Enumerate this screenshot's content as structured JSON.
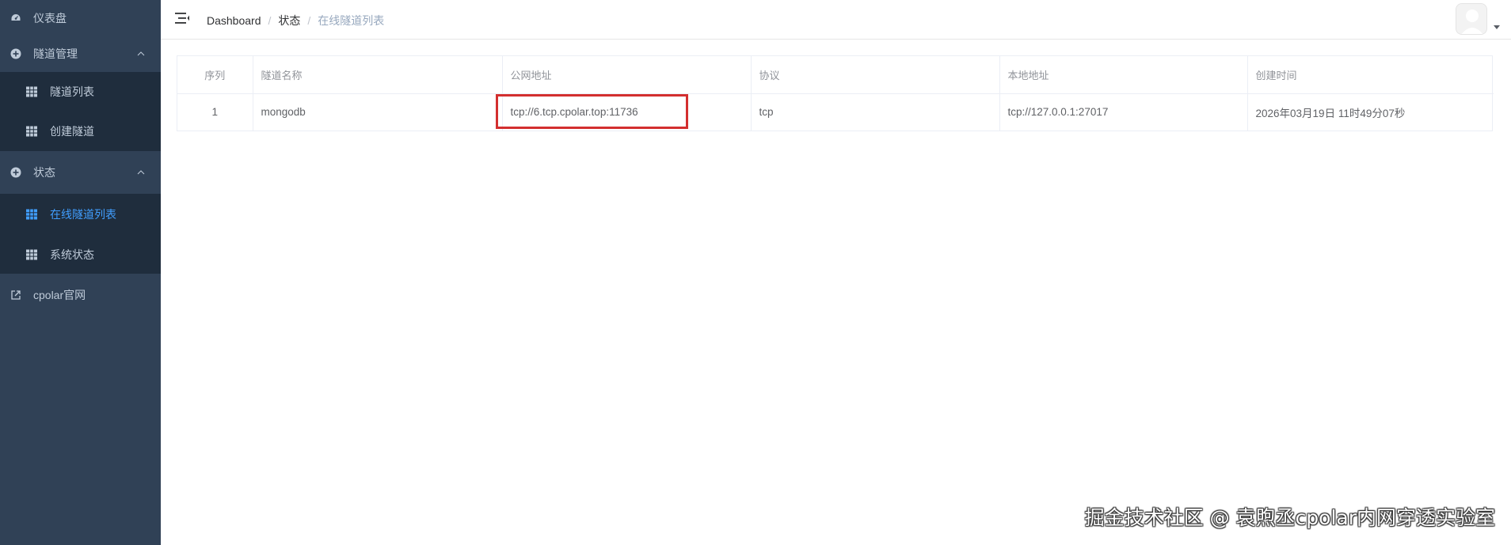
{
  "sidebar": {
    "dashboard_label": "仪表盘",
    "tunnel_mgmt": {
      "label": "隧道管理",
      "items": [
        {
          "label": "隧道列表"
        },
        {
          "label": "创建隧道"
        }
      ]
    },
    "status": {
      "label": "状态",
      "items": [
        {
          "label": "在线隧道列表"
        },
        {
          "label": "系统状态"
        }
      ]
    },
    "official_site_label": "cpolar官网"
  },
  "breadcrumb": {
    "items": [
      "Dashboard",
      "状态",
      "在线隧道列表"
    ],
    "separator": "/"
  },
  "table": {
    "columns": [
      "序列",
      "隧道名称",
      "公网地址",
      "协议",
      "本地地址",
      "创建时间"
    ],
    "rows": [
      {
        "index": "1",
        "name": "mongodb",
        "public_addr": "tcp://6.tcp.cpolar.top:11736",
        "protocol": "tcp",
        "local_addr": "tcp://127.0.0.1:27017",
        "created": "2026年03月19日 11时49分07秒"
      }
    ]
  },
  "watermark": "掘金技术社区 @ 袁煦丞cpolar内网穿透实验室",
  "colors": {
    "sidebar_bg": "#304156",
    "submenu_bg": "#1f2d3d",
    "menu_text": "#bfcbd9",
    "active": "#409eff",
    "highlight_border": "#d32f2f"
  }
}
